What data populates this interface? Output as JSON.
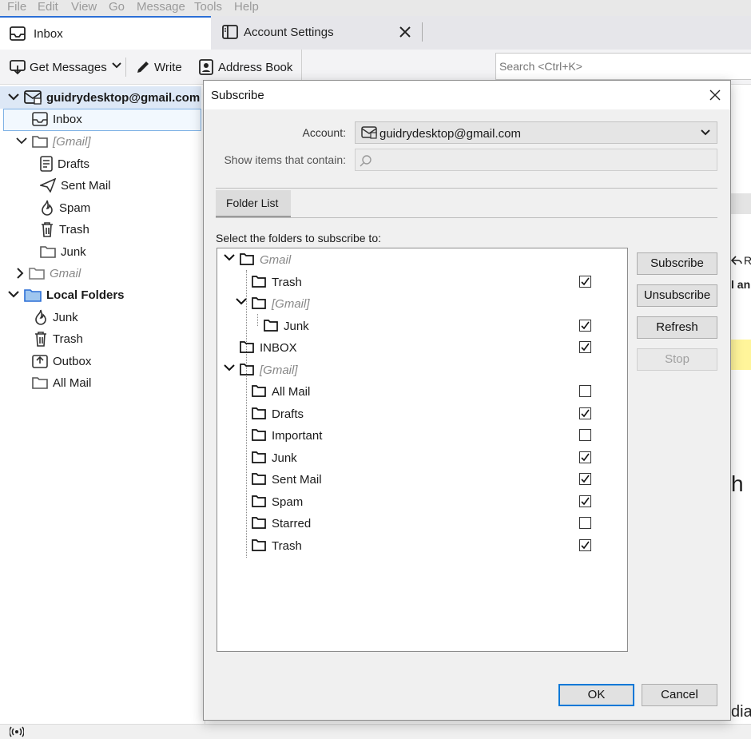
{
  "menubar": {
    "items": [
      "File",
      "Edit",
      "View",
      "Go",
      "Message",
      "Tools",
      "Help"
    ]
  },
  "tabs": [
    {
      "label": "Inbox",
      "icon": "inbox-icon"
    },
    {
      "label": "Account Settings",
      "icon": "settings-book-icon"
    }
  ],
  "toolbar": {
    "get_messages": "Get Messages",
    "write": "Write",
    "address_book": "Address Book",
    "search_placeholder": "Search <Ctrl+K>"
  },
  "folder_pane": {
    "account": "guidrydesktop@gmail.com",
    "items": [
      {
        "label": "Inbox"
      },
      {
        "label": "[Gmail]"
      },
      {
        "label": "Drafts"
      },
      {
        "label": "Sent Mail"
      },
      {
        "label": "Spam"
      },
      {
        "label": "Trash"
      },
      {
        "label": "Junk"
      },
      {
        "label": "Gmail"
      },
      {
        "label": "Local Folders"
      },
      {
        "label": "Junk"
      },
      {
        "label": "Trash"
      },
      {
        "label": "Outbox"
      },
      {
        "label": "All Mail"
      }
    ]
  },
  "background": {
    "frag1": "R",
    "frag2": "l an",
    "frag3": "h",
    "frag4": "dia"
  },
  "dialog": {
    "title": "Subscribe",
    "account_label": "Account:",
    "account_value": "guidrydesktop@gmail.com",
    "filter_label": "Show items that contain:",
    "filter_value": "",
    "tab_label": "Folder List",
    "instruction": "Select the folders to subscribe to:",
    "folders": [
      {
        "name": "Gmail",
        "checked": null
      },
      {
        "name": "Trash",
        "checked": true
      },
      {
        "name": "[Gmail]",
        "checked": null
      },
      {
        "name": "Junk",
        "checked": true
      },
      {
        "name": "INBOX",
        "checked": true
      },
      {
        "name": "[Gmail]",
        "checked": null
      },
      {
        "name": "All Mail",
        "checked": false
      },
      {
        "name": "Drafts",
        "checked": true
      },
      {
        "name": "Important",
        "checked": false
      },
      {
        "name": "Junk",
        "checked": true
      },
      {
        "name": "Sent Mail",
        "checked": true
      },
      {
        "name": "Spam",
        "checked": true
      },
      {
        "name": "Starred",
        "checked": false
      },
      {
        "name": "Trash",
        "checked": true
      }
    ],
    "buttons": {
      "subscribe": "Subscribe",
      "unsubscribe": "Unsubscribe",
      "refresh": "Refresh",
      "stop": "Stop",
      "ok": "OK",
      "cancel": "Cancel"
    }
  }
}
